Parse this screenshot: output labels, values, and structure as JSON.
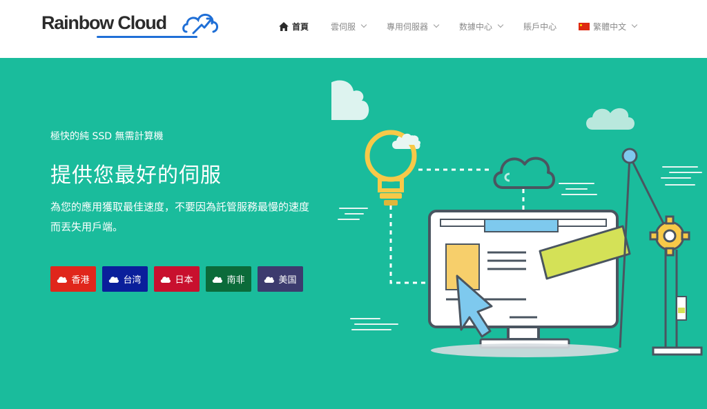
{
  "brand": {
    "name": "Rainbow Cloud",
    "accent": "#1f6fd6"
  },
  "nav": {
    "items": [
      {
        "label": "首頁",
        "icon": "home-icon",
        "active": true,
        "dropdown": false
      },
      {
        "label": "雲伺服",
        "dropdown": true
      },
      {
        "label": "專用伺服器",
        "dropdown": true
      },
      {
        "label": "数據中心",
        "dropdown": true
      },
      {
        "label": "賬戶中心",
        "dropdown": false
      },
      {
        "label": "繁體中文",
        "icon": "china-flag-icon",
        "dropdown": true
      }
    ]
  },
  "hero": {
    "background": "#1abc9c",
    "subhead": "極快的純 SSD 無需計算機",
    "headline": "提供您最好的伺服",
    "description": "為您的應用獲取最佳速度，不要因為託管服務最慢的速度而丟失用戶端。",
    "locations": [
      {
        "label": "香港",
        "color": "#e0261b"
      },
      {
        "label": "台湾",
        "color": "#0a1f9b"
      },
      {
        "label": "日本",
        "color": "#c8102e"
      },
      {
        "label": "南非",
        "color": "#0b6b3a"
      },
      {
        "label": "美国",
        "color": "#3c3b6e"
      }
    ]
  }
}
